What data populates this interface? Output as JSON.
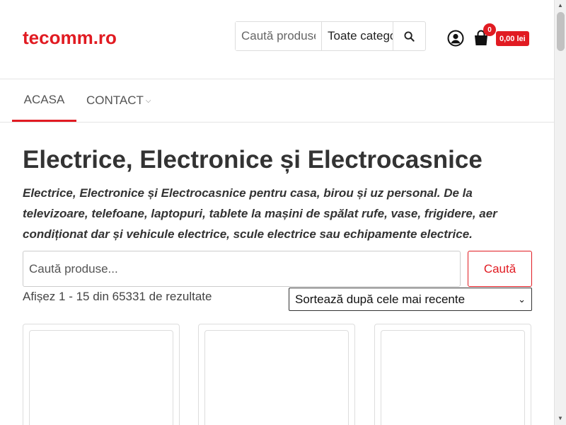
{
  "header": {
    "logo": "tecomm.ro",
    "search_placeholder": "Caută produse...",
    "category_selected": "Toate categoriile",
    "cart_count": "0",
    "cart_total": "0,00 lei"
  },
  "nav": {
    "items": [
      {
        "label": "ACASA",
        "active": true
      },
      {
        "label": "CONTACT",
        "has_dropdown": true
      }
    ]
  },
  "main": {
    "title": "Electrice, Electronice și Electrocasnice",
    "description": "Electrice, Electronice și Electrocasnice pentru casa, birou și uz personal. De la televizoare, telefoane, laptopuri, tablete la mașini de spălat rufe, vase, frigidere, aer condiționat dar și vehicule electrice, scule electrice sau echipamente electrice.",
    "search_placeholder": "Caută produse...",
    "search_button": "Caută",
    "results_text": "Afișez 1 - 15 din 65331 de rezultate",
    "sort_selected": "Sortează după cele mai recente"
  },
  "colors": {
    "accent": "#e11b22",
    "text": "#333333"
  },
  "icons": [
    "search-icon",
    "account-icon",
    "cart-icon",
    "chevron-down-icon"
  ]
}
